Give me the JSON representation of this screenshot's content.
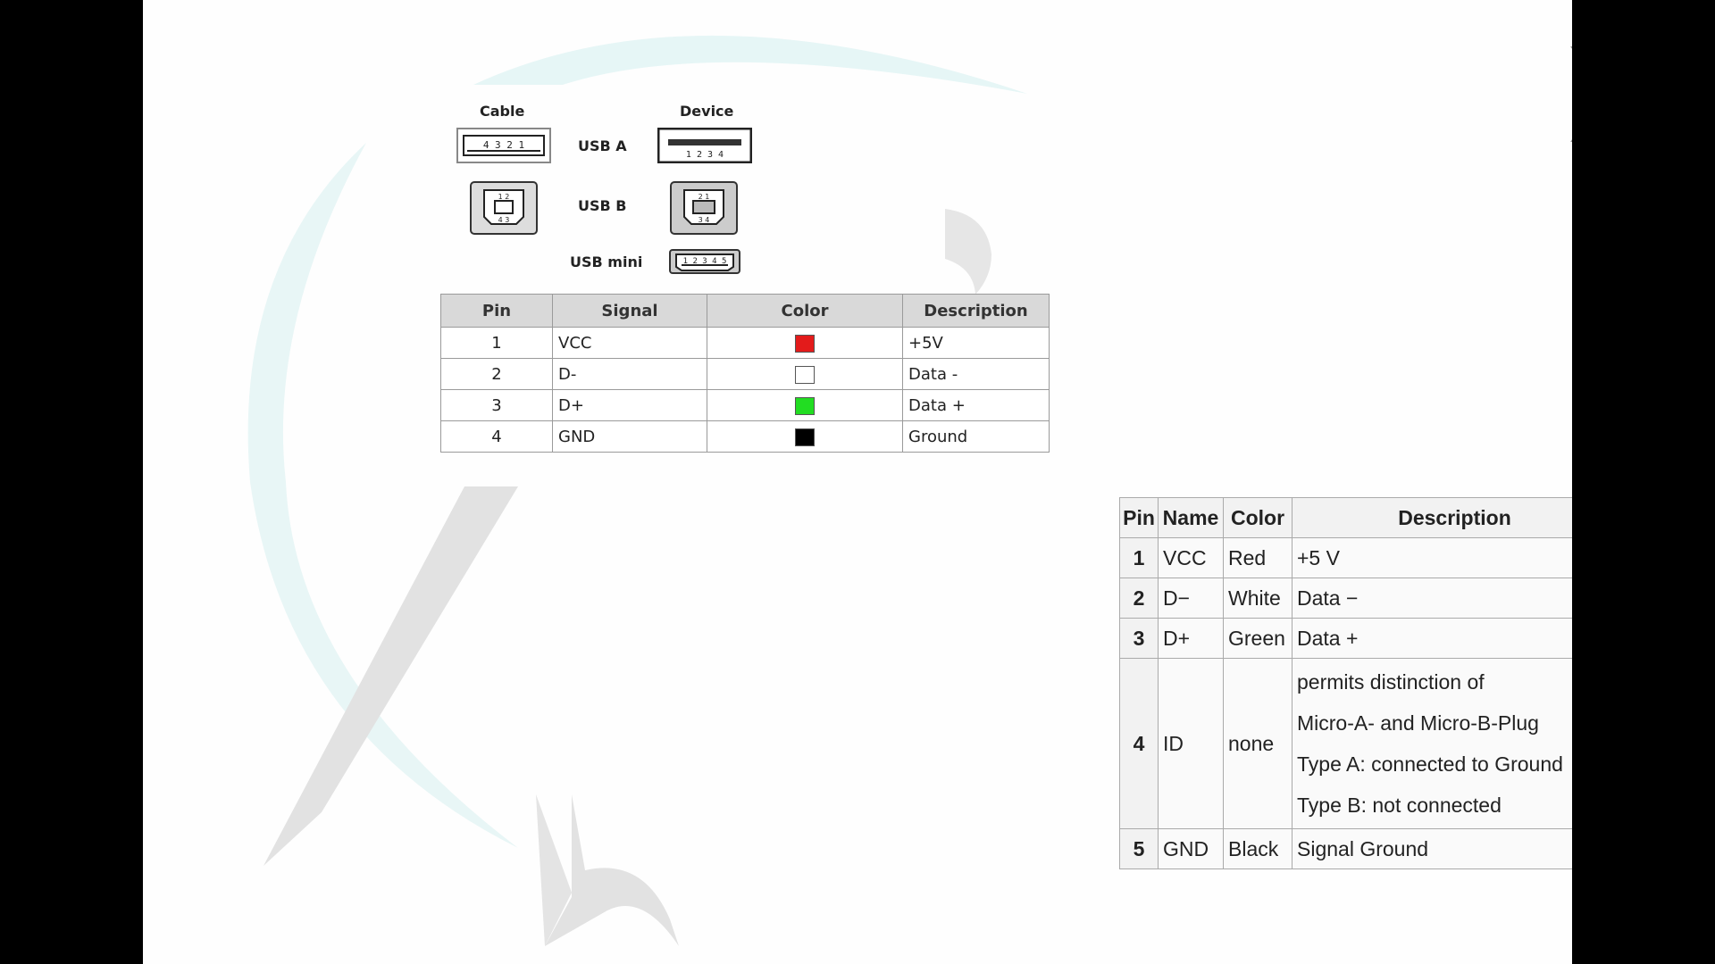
{
  "connectors": {
    "cable_label": "Cable",
    "device_label": "Device",
    "usb_a_label": "USB A",
    "usb_b_label": "USB B",
    "usb_mini_label": "USB mini",
    "usb_a_cable_pins": "4 3 2 1",
    "usb_a_device_pins": "1 2 3 4"
  },
  "table1": {
    "headers": [
      "Pin",
      "Signal",
      "Color",
      "Description"
    ],
    "rows": [
      {
        "pin": "1",
        "signal": "VCC",
        "color": "#e31b1b",
        "description": "+5V"
      },
      {
        "pin": "2",
        "signal": "D-",
        "color": "#ffffff",
        "description": "Data -"
      },
      {
        "pin": "3",
        "signal": "D+",
        "color": "#22dd22",
        "description": "Data +"
      },
      {
        "pin": "4",
        "signal": "GND",
        "color": "#000000",
        "description": "Ground"
      }
    ]
  },
  "table2": {
    "headers": [
      "Pin",
      "Name",
      "Color",
      "Description"
    ],
    "rows": [
      {
        "pin": "1",
        "name": "VCC",
        "color": "Red",
        "description": [
          "+5 V"
        ]
      },
      {
        "pin": "2",
        "name": "D−",
        "color": "White",
        "description": [
          "Data −"
        ]
      },
      {
        "pin": "3",
        "name": "D+",
        "color": "Green",
        "description": [
          "Data +"
        ]
      },
      {
        "pin": "4",
        "name": "ID",
        "color": "none",
        "description": [
          "permits distinction of",
          "Micro-A- and Micro-B-Plug",
          "Type A: connected to Ground",
          "Type B: not connected"
        ]
      },
      {
        "pin": "5",
        "name": "GND",
        "color": "Black",
        "description": [
          "Signal Ground"
        ]
      }
    ]
  }
}
